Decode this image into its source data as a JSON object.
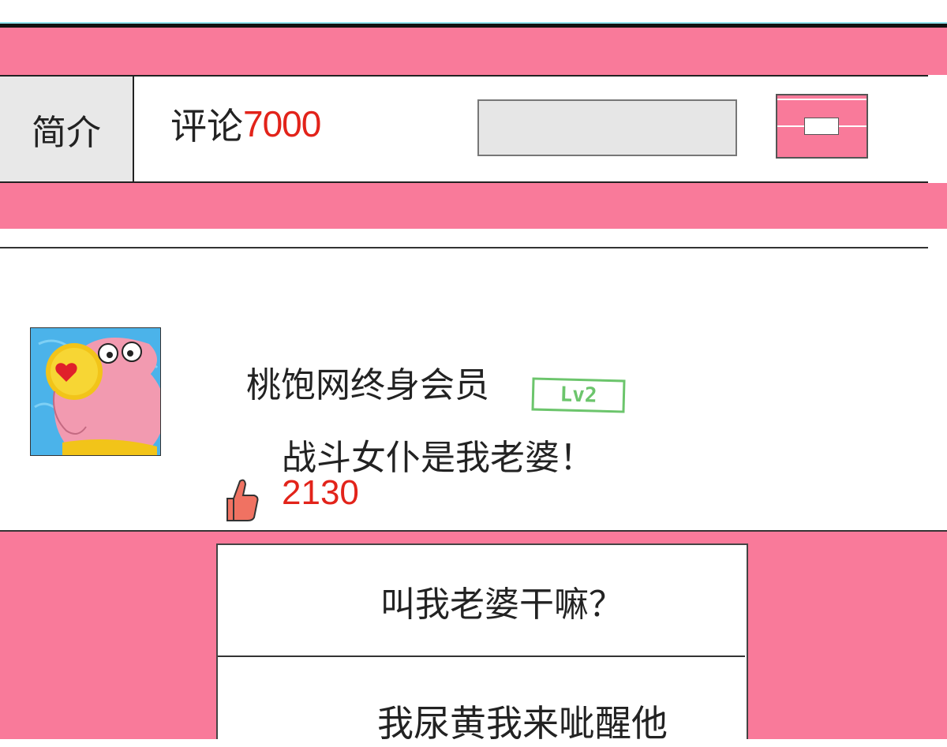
{
  "tabs": {
    "intro_label": "简介",
    "comments_label": "评论",
    "comments_count": "7000"
  },
  "comment": {
    "username": "桃饱网终身会员",
    "level": "Lv2",
    "text": "战斗女仆是我老婆！",
    "likes": "2130"
  },
  "popup_menu": {
    "items": [
      "叫我老婆干嘛？",
      "我尿黄我来呲醒他"
    ]
  },
  "colors": {
    "pink": "#f97a9a",
    "red": "#e2231a",
    "green_badge": "#6cc56c"
  },
  "icons": {
    "like": "thumbs-up-icon",
    "toggle": "toggle-switch-icon"
  }
}
